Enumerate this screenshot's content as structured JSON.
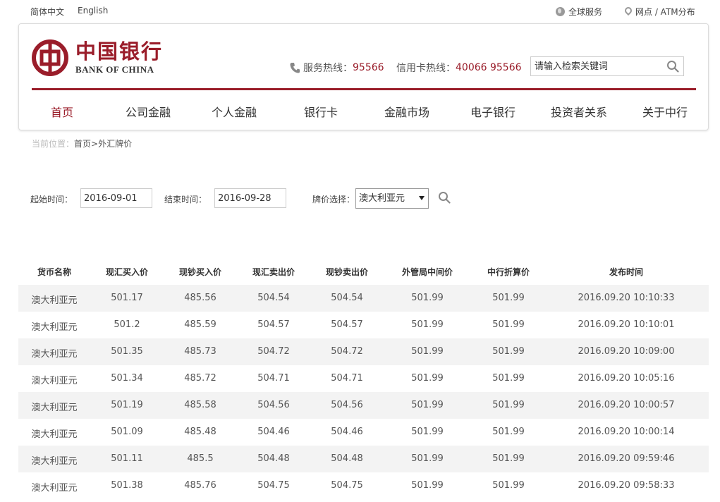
{
  "topbar": {
    "lang_cn": "简体中文",
    "lang_en": "English",
    "global_service": "全球服务",
    "atm": "网点 / ATM分布"
  },
  "header": {
    "logo_cn": "中国银行",
    "logo_en": "BANK OF CHINA",
    "hotline_label": "服务热线：",
    "hotline_number": "95566",
    "card_hotline_label": "信用卡热线：",
    "card_hotline_number": "40066 95566",
    "search_placeholder": "请输入检索关键词",
    "brand_color": "#9a1d2a"
  },
  "nav": {
    "items": [
      {
        "label": "首页",
        "active": true
      },
      {
        "label": "公司金融"
      },
      {
        "label": "个人金融"
      },
      {
        "label": "银行卡"
      },
      {
        "label": "金融市场"
      },
      {
        "label": "电子银行"
      },
      {
        "label": "投资者关系"
      },
      {
        "label": "关于中行"
      }
    ]
  },
  "breadcrumb": {
    "prefix": "当前位置：",
    "path": "首页>外汇牌价"
  },
  "filter": {
    "start_label": "起始时间：",
    "start_value": "2016-09-01",
    "end_label": "结束时间：",
    "end_value": "2016-09-28",
    "currency_label": "牌价选择：",
    "currency_value": "澳大利亚元"
  },
  "table": {
    "headers": [
      "货币名称",
      "现汇买入价",
      "现钞买入价",
      "现汇卖出价",
      "现钞卖出价",
      "外管局中间价",
      "中行折算价",
      "发布时间"
    ],
    "rows": [
      [
        "澳大利亚元",
        "501.17",
        "485.56",
        "504.54",
        "504.54",
        "501.99",
        "501.99",
        "2016.09.20 10:10:33"
      ],
      [
        "澳大利亚元",
        "501.2",
        "485.59",
        "504.57",
        "504.57",
        "501.99",
        "501.99",
        "2016.09.20 10:10:01"
      ],
      [
        "澳大利亚元",
        "501.35",
        "485.73",
        "504.72",
        "504.72",
        "501.99",
        "501.99",
        "2016.09.20 10:09:00"
      ],
      [
        "澳大利亚元",
        "501.34",
        "485.72",
        "504.71",
        "504.71",
        "501.99",
        "501.99",
        "2016.09.20 10:05:16"
      ],
      [
        "澳大利亚元",
        "501.19",
        "485.58",
        "504.56",
        "504.56",
        "501.99",
        "501.99",
        "2016.09.20 10:00:57"
      ],
      [
        "澳大利亚元",
        "501.09",
        "485.48",
        "504.46",
        "504.46",
        "501.99",
        "501.99",
        "2016.09.20 10:00:14"
      ],
      [
        "澳大利亚元",
        "501.11",
        "485.5",
        "504.48",
        "504.48",
        "501.99",
        "501.99",
        "2016.09.20 09:59:46"
      ],
      [
        "澳大利亚元",
        "501.38",
        "485.76",
        "504.75",
        "504.75",
        "501.99",
        "501.99",
        "2016.09.20 09:58:33"
      ]
    ]
  }
}
